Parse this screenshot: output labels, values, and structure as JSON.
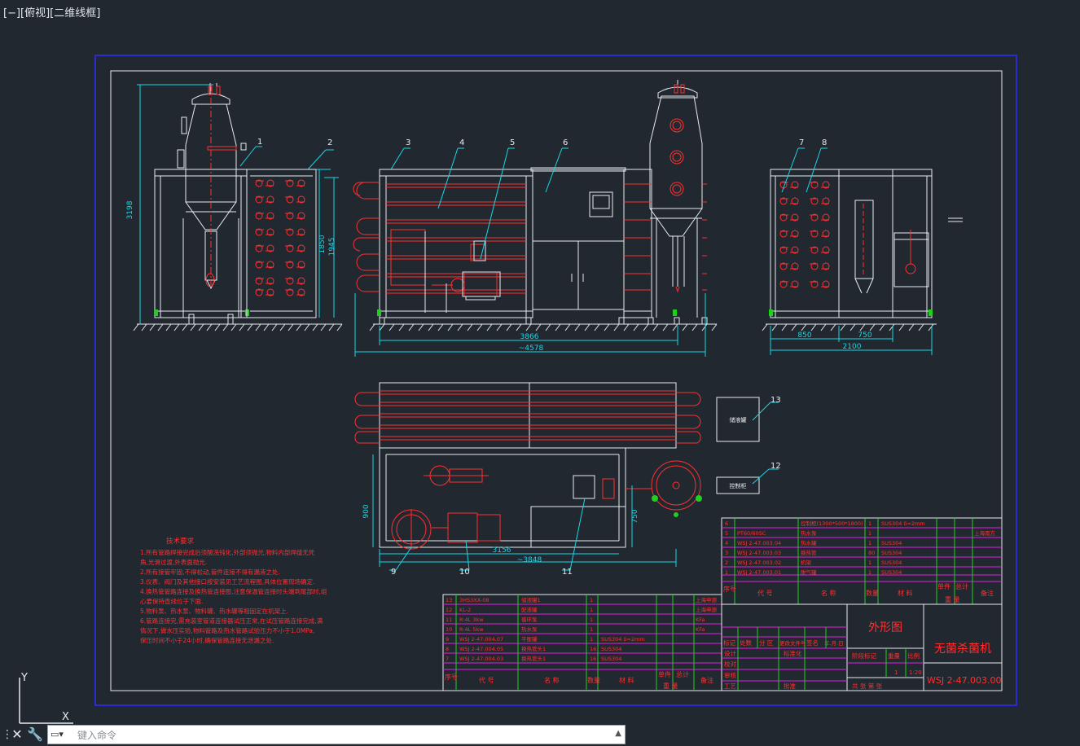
{
  "viewport": {
    "label": "[−][俯视][二维线框]"
  },
  "command": {
    "placeholder": "键入命令"
  },
  "balloons": [
    "1",
    "2",
    "3",
    "4",
    "5",
    "6",
    "7",
    "8",
    "9",
    "10",
    "11",
    "12",
    "13"
  ],
  "dimensions": {
    "d_3198": "3198",
    "d_1850": "1850",
    "d_1945": "1945",
    "d_3866": "3866",
    "d_4578": "~4578",
    "d_850": "850",
    "d_750": "750",
    "d_2100": "2100",
    "d_900": "900",
    "d_750b": "750",
    "d_3156": "3156",
    "d_3848": "~3848"
  },
  "box_labels": {
    "b13": "储液罐",
    "b12": "控制柜"
  },
  "tech": {
    "title": "技术要求",
    "lines": [
      "1.所有管路焊接完成后须酸洗钝化,外部须抛光,物料内部焊缝无死",
      "角,光滑过渡,外表面抛光.",
      "2.所有接管牢固,不得松动,管件连接不得有漏液之处.",
      "3.仪表、阀门及其他接口按安装见工艺流程图,具体位置现场确定.",
      "4.换热管管路连接及换热管连接图,注意保温管连接时头端到尾部时,组",
      "心要保持直线位于下面.",
      "5.物料泵、热水泵、物料罐、热水罐等相固定在机架上.",
      "6.管路连接完,需充装室管道连接器试压正常,在试压管路连接完成,满",
      "情况下,做水压实验,物料管路及热水管路试验压力不小于1.0MPa,",
      "保压时间不小于24小时,确保管路连接无泄漏之处."
    ]
  },
  "bom_left": {
    "rows": [
      {
        "no": "13",
        "code": "3HS3XX-08",
        "name": "储液罐1",
        "qty": "1",
        "mat": "",
        "note": "上海申源"
      },
      {
        "no": "12",
        "code": "KL-2",
        "name": "配液罐",
        "qty": "1",
        "mat": "",
        "note": "上海申源"
      },
      {
        "no": "11",
        "code": "R:4L 3kw",
        "name": "循环泵",
        "qty": "1",
        "mat": "",
        "note": "KFa"
      },
      {
        "no": "10",
        "code": "R:4L 5kw",
        "name": "热水泵",
        "qty": "1",
        "mat": "",
        "note": "KFa"
      },
      {
        "no": "9",
        "code": "WSJ 2-47.004.07",
        "name": "平衡罐",
        "qty": "1",
        "mat": "SUS304 δ=2mm",
        "note": ""
      },
      {
        "no": "8",
        "code": "WSJ 2-47.004.05",
        "name": "换热管头1",
        "qty": "16",
        "mat": "SUS304",
        "note": ""
      },
      {
        "no": "7",
        "code": "WSJ 2-47.004.03",
        "name": "换热管头1",
        "qty": "16",
        "mat": "SUS304",
        "note": ""
      }
    ],
    "header": {
      "no": "序号",
      "code": "代 号",
      "name": "名 称",
      "qty": "数量",
      "mat": "材 料",
      "unit": "单件",
      "total": "总计",
      "weight": "重 量",
      "note": "备注"
    }
  },
  "bom_right": {
    "rows": [
      {
        "no": "6",
        "code": "",
        "name": "控制柜(1300*500*1800)",
        "qty": "1",
        "mat": "SUS304 δ=2mm",
        "note": ""
      },
      {
        "no": "5",
        "code": "PT60/60SC",
        "name": "热水泵",
        "qty": "1",
        "mat": "",
        "note": "上海南方"
      },
      {
        "no": "4",
        "code": "WSJ 2-47.003.04",
        "name": "热水罐",
        "qty": "1",
        "mat": "SUS304",
        "note": ""
      },
      {
        "no": "3",
        "code": "WSJ 2-47.003.03",
        "name": "换热管",
        "qty": "80",
        "mat": "SUS304",
        "note": ""
      },
      {
        "no": "2",
        "code": "WSJ 2-47.003.02",
        "name": "机架",
        "qty": "1",
        "mat": "SUS304",
        "note": ""
      },
      {
        "no": "1",
        "code": "WSJ 2-47.003.01",
        "name": "脱气罐",
        "qty": "1",
        "mat": "SUS304",
        "note": ""
      }
    ],
    "header": {
      "no": "序号",
      "code": "代 号",
      "name": "名 称",
      "qty": "数量",
      "mat": "材 料",
      "unit": "单件",
      "total": "总计",
      "weight": "重 量",
      "note": "备注"
    }
  },
  "titleblock": {
    "drawing_name": "外形图",
    "product_name": "无菌杀菌机",
    "drawing_no": "WSJ 2-47.003.00",
    "scale": "1:20",
    "qty": "1",
    "c_mark": "标记",
    "c_count": "处数",
    "c_zone": "分 区",
    "c_doc": "更改文件号",
    "c_sign": "签名",
    "c_date": "年.月.日",
    "c_design": "设计",
    "c_std": "标准化",
    "c_check": "校对",
    "c_review": "审核",
    "c_process": "工艺",
    "c_approve": "批准",
    "c_stage": "阶段标记",
    "c_weight": "重量",
    "c_ratio": "比例",
    "c_sheets": "共  张  第  张"
  },
  "colors": {
    "bg": "#212830",
    "frame_blue": "#2a2cd0",
    "border": "#e8ecef",
    "cyan": "#18d8e8",
    "red": "#ff3030",
    "magenta": "#e020e0",
    "green": "#20d020",
    "white": "#e8ecef"
  }
}
